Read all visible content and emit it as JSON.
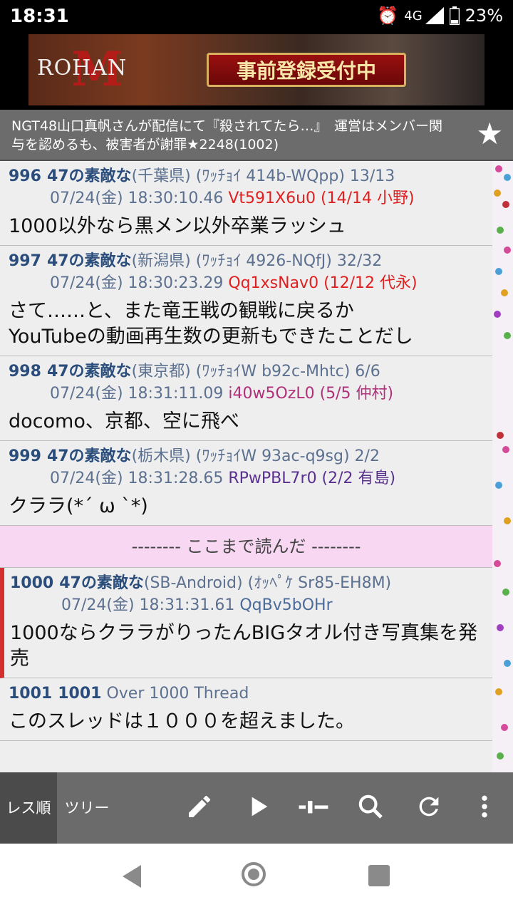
{
  "status_bar": {
    "time": "18:31",
    "network": "4G",
    "battery": "23%"
  },
  "ad": {
    "logo": "ROHAN",
    "logo_mark": "M",
    "button": "事前登録受付中"
  },
  "thread": {
    "title": "NGT48山口真帆さんが配信にて『殺されてたら…』　運営はメンバー関与を認めるも、被害者が謝罪★2248(1002)"
  },
  "posts": [
    {
      "number": "996",
      "name": "47の素敵な",
      "region": "(千葉県)",
      "trip": "(ﾜｯﾁｮｲ 414b-WQpp) 13/13",
      "datetime": "07/24(金) 18:30:10.46",
      "id": "Vt591X6u0 (14/14 小野)",
      "body": "1000以外なら黒メン以外卒業ラッシュ"
    },
    {
      "number": "997",
      "name": "47の素敵な",
      "region": "(新潟県)",
      "trip": "(ﾜｯﾁｮｲ 4926-NQfJ) 32/32",
      "datetime": "07/24(金) 18:30:23.29",
      "id": "Qq1xsNav0 (12/12 代永)",
      "body": "さて……と、また竜王戦の観戦に戻るか\nYouTubeの動画再生数の更新もできたことだし"
    },
    {
      "number": "998",
      "name": "47の素敵な",
      "region": "(東京都)",
      "trip": "(ﾜｯﾁｮｲW b92c-Mhtc) 6/6",
      "datetime": "07/24(金) 18:31:11.09",
      "id": "i40w5OzL0 (5/5 仲村)",
      "body": "docomo、京都、空に飛べ"
    },
    {
      "number": "999",
      "name": "47の素敵な",
      "region": "(栃木県)",
      "trip": "(ﾜｯﾁｮｲW 93ac-q9sg) 2/2",
      "datetime": "07/24(金) 18:31:28.65",
      "id": "RPwPBL7r0 (2/2 有島)",
      "body": "クララ(*´ ω `*)"
    }
  ],
  "read_marker": "-------- ここまで読んだ --------",
  "new_posts": [
    {
      "number": "1000",
      "name": "47の素敵な",
      "region": "(SB-Android)",
      "trip": "(ｵｯﾍﾟｹ Sr85-EH8M)",
      "datetime": "07/24(金) 18:31:31.61",
      "id": "QqBv5bOHr",
      "body": "1000ならクララがりったんBIGタオル付き写真集を発売"
    },
    {
      "number": "1001",
      "name": "1001",
      "region": "",
      "trip": "Over 1000 Thread",
      "body": "このスレッドは１０００を超えました。"
    }
  ],
  "toolbar": {
    "tab_res_order": "レス順",
    "tab_tree": "ツリー",
    "icons": [
      "pencil-icon",
      "play-icon",
      "slider-icon",
      "search-icon",
      "refresh-icon",
      "more-icon"
    ]
  },
  "colors": {
    "accent_red": "#d32f2f",
    "read_marker_bg": "#f7d7f2",
    "title_bar_bg": "#6c6c6c"
  }
}
